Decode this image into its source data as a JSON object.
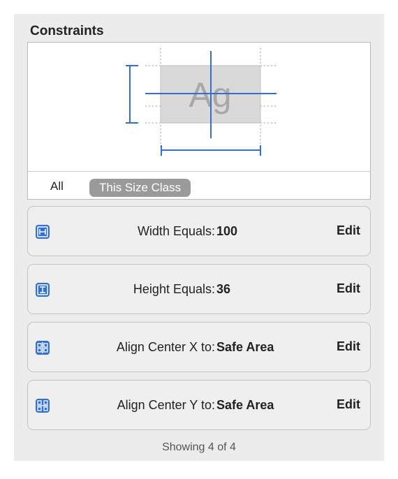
{
  "section": {
    "title": "Constraints"
  },
  "preview": {
    "sample_text": "Ag",
    "filter": {
      "all_label": "All",
      "size_class_label": "This Size Class"
    }
  },
  "constraints": [
    {
      "icon": "width-constraint-icon",
      "label": "Width Equals:",
      "value": "100",
      "edit": "Edit"
    },
    {
      "icon": "height-constraint-icon",
      "label": "Height Equals:",
      "value": "36",
      "edit": "Edit"
    },
    {
      "icon": "align-center-x-icon",
      "label": "Align Center X to:",
      "value": "Safe Area",
      "edit": "Edit"
    },
    {
      "icon": "align-center-y-icon",
      "label": "Align Center Y to:",
      "value": "Safe Area",
      "edit": "Edit"
    }
  ],
  "status": "Showing 4 of 4",
  "colors": {
    "accent": "#2f6fd6",
    "panel": "#ececec"
  }
}
